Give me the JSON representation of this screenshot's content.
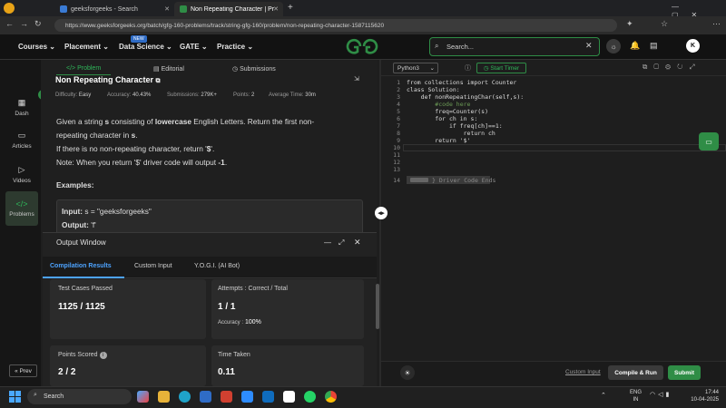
{
  "browser": {
    "tabs": [
      {
        "title": "geeksforgeeks - Search"
      },
      {
        "title": "Non Repeating Character | Practic"
      }
    ],
    "url": "https://www.geeksforgeeks.org/batch/gfg-160-problems/track/string-gfg-160/problem/non-repeating-character-1587115620"
  },
  "nav": {
    "items": [
      "Courses",
      "Placement",
      "Data Science",
      "GATE",
      "Practice"
    ],
    "badge": "NEW",
    "logo": "GG",
    "search_placeholder": "Search...",
    "avatar": "K"
  },
  "rail": {
    "items": [
      {
        "label": "Dash",
        "icon": "dashboard-icon"
      },
      {
        "label": "Articles",
        "icon": "article-icon"
      },
      {
        "label": "Videos",
        "icon": "video-icon"
      },
      {
        "label": "Problems",
        "icon": "code-icon"
      }
    ],
    "prev": "« Prev"
  },
  "problem": {
    "tabs": [
      "Problem",
      "Editorial",
      "Submissions"
    ],
    "title": "Non Repeating Character",
    "meta": {
      "difficulty_label": "Difficulty:",
      "difficulty": "Easy",
      "accuracy_label": "Accuracy:",
      "accuracy": "40.43%",
      "submissions_label": "Submissions:",
      "submissions": "279K+",
      "points_label": "Points:",
      "points": "2",
      "time_label": "Average Time:",
      "time": "30m"
    },
    "statement": {
      "line1a": "Given a string ",
      "s1": "s",
      "line1b": " consisting of ",
      "lower": "lowercase",
      "line1c": " English Letters. Return the first non-",
      "line2a": "repeating character in ",
      "s2": "s",
      "line2b": ".",
      "line3a": "If there is no non-repeating character, return '",
      "dollar": "$",
      "line3b": "'.",
      "line4a": "Note: When you return '$' driver code will output ",
      "neg1": "-1",
      "line4b": "."
    },
    "examples_heading": "Examples:",
    "example": {
      "input_label": "Input:",
      "input_value": "s = \"geeksforgeeks\"",
      "output_label": "Output:",
      "output_value": "'f'"
    }
  },
  "output_window": {
    "title": "Output Window",
    "tabs": [
      "Compilation Results",
      "Custom Input",
      "Y.O.G.I. (AI Bot)"
    ],
    "cards": {
      "tests_label": "Test Cases Passed",
      "tests_value": "1125 / 1125",
      "attempts_label": "Attempts : Correct / Total",
      "attempts_value": "1 / 1",
      "accuracy_label": "Accuracy :",
      "accuracy_value": "100%",
      "points_label": "Points Scored",
      "points_value": "2 / 2",
      "time_label": "Time Taken",
      "time_value": "0.11"
    }
  },
  "editor": {
    "language": "Python3",
    "timer": "Start Timer",
    "lines": [
      "from collections import Counter",
      "class Solution:",
      "    def nonRepeatingChar(self,s):",
      "        #code here",
      "        freq=Counter(s)",
      "        for ch in s:",
      "            if freq[ch]==1:",
      "                return ch",
      "        return '$'",
      "",
      "",
      "",
      "",
      "} Driver Code Ends"
    ],
    "custom_input": "Custom Input",
    "compile": "Compile & Run",
    "submit": "Submit"
  },
  "taskbar": {
    "search": "Search",
    "lang": "ENG",
    "region": "IN",
    "time": "17:44",
    "date": "10-04-2025"
  },
  "colors": {
    "accent": "#2f8d46",
    "background": "#1e1e1e"
  }
}
